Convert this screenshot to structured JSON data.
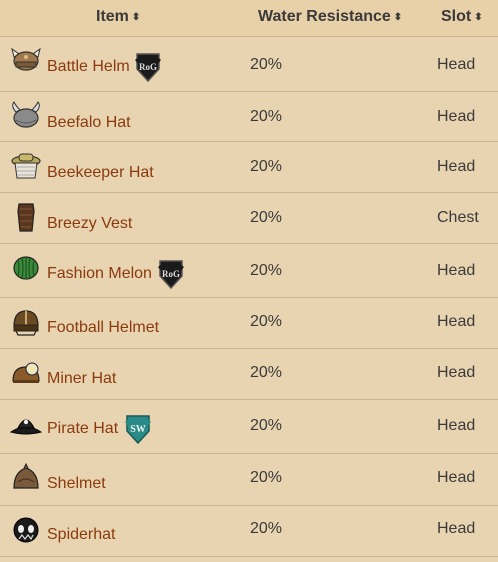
{
  "headers": {
    "item": "Item",
    "water": "Water Resistance",
    "slot": "Slot",
    "sort_glyph": "⬍"
  },
  "rows": [
    {
      "name": "Battle Helm",
      "water": "20%",
      "slot": "Head",
      "icon": "battle-helm-icon",
      "badge": "RoG"
    },
    {
      "name": "Beefalo Hat",
      "water": "20%",
      "slot": "Head",
      "icon": "beefalo-hat-icon",
      "badge": ""
    },
    {
      "name": "Beekeeper Hat",
      "water": "20%",
      "slot": "Head",
      "icon": "beekeeper-hat-icon",
      "badge": ""
    },
    {
      "name": "Breezy Vest",
      "water": "20%",
      "slot": "Chest",
      "icon": "breezy-vest-icon",
      "badge": ""
    },
    {
      "name": "Fashion Melon",
      "water": "20%",
      "slot": "Head",
      "icon": "fashion-melon-icon",
      "badge": "RoG"
    },
    {
      "name": "Football Helmet",
      "water": "20%",
      "slot": "Head",
      "icon": "football-helmet-icon",
      "badge": ""
    },
    {
      "name": "Miner Hat",
      "water": "20%",
      "slot": "Head",
      "icon": "miner-hat-icon",
      "badge": ""
    },
    {
      "name": "Pirate Hat",
      "water": "20%",
      "slot": "Head",
      "icon": "pirate-hat-icon",
      "badge": "SW"
    },
    {
      "name": "Shelmet",
      "water": "20%",
      "slot": "Head",
      "icon": "shelmet-icon",
      "badge": ""
    },
    {
      "name": "Spiderhat",
      "water": "20%",
      "slot": "Head",
      "icon": "spiderhat-icon",
      "badge": ""
    }
  ],
  "colors": {
    "background": "#e8d4b0",
    "link": "#8b3a0f",
    "border": "#c9b48e"
  }
}
